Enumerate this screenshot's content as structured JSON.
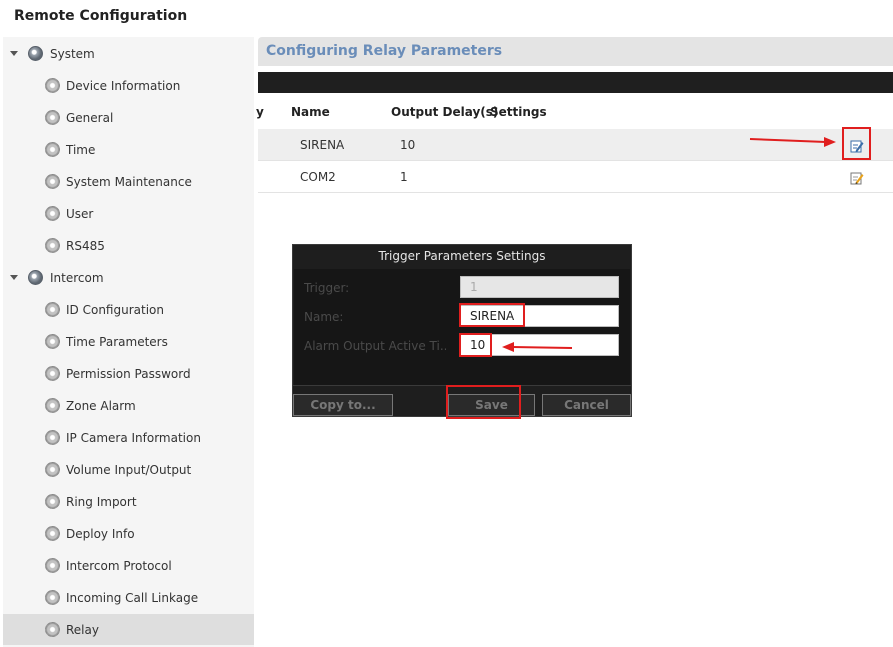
{
  "app": {
    "title": "Remote Configuration"
  },
  "sidebar": {
    "groups": [
      {
        "label": "System",
        "icon": "gear-globe-icon",
        "items": [
          {
            "label": "Device Information",
            "icon": "gear-icon"
          },
          {
            "label": "General",
            "icon": "gear-icon"
          },
          {
            "label": "Time",
            "icon": "gear-icon"
          },
          {
            "label": "System Maintenance",
            "icon": "gear-icon"
          },
          {
            "label": "User",
            "icon": "gear-icon"
          },
          {
            "label": "RS485",
            "icon": "gear-icon"
          }
        ]
      },
      {
        "label": "Intercom",
        "icon": "gear-globe-icon",
        "items": [
          {
            "label": "ID Configuration",
            "icon": "gear-icon"
          },
          {
            "label": "Time Parameters",
            "icon": "gear-icon"
          },
          {
            "label": "Permission Password",
            "icon": "gear-icon"
          },
          {
            "label": "Zone Alarm",
            "icon": "gear-icon"
          },
          {
            "label": "IP Camera Information",
            "icon": "gear-icon"
          },
          {
            "label": "Volume Input/Output",
            "icon": "gear-icon"
          },
          {
            "label": "Ring Import",
            "icon": "gear-icon"
          },
          {
            "label": "Deploy Info",
            "icon": "gear-icon"
          },
          {
            "label": "Intercom Protocol",
            "icon": "gear-icon"
          },
          {
            "label": "Incoming Call Linkage",
            "icon": "gear-icon"
          },
          {
            "label": "Relay",
            "icon": "gear-icon",
            "selected": true
          }
        ]
      }
    ]
  },
  "main": {
    "section_title": "Configuring Relay Parameters",
    "table": {
      "columns": [
        "y",
        "Name",
        "Output Delay(s)",
        "Settings"
      ],
      "rows": [
        {
          "name": "SIRENA",
          "delay": "10"
        },
        {
          "name": "COM2",
          "delay": "1"
        }
      ]
    }
  },
  "dialog": {
    "title": "Trigger Parameters Settings",
    "fields": {
      "trigger": {
        "label": "Trigger:",
        "value": "1"
      },
      "name": {
        "label": "Name:",
        "value": "SIRENA"
      },
      "alarm": {
        "label": "Alarm Output Active Ti...",
        "value": "10"
      }
    },
    "buttons": {
      "copy": "Copy to...",
      "save": "Save",
      "cancel": "Cancel"
    }
  },
  "colors": {
    "accent": "#6a8db9",
    "annotation": "#e01e1e",
    "dialog_bg": "#1e1e1e",
    "selected_row": "#dedede"
  }
}
